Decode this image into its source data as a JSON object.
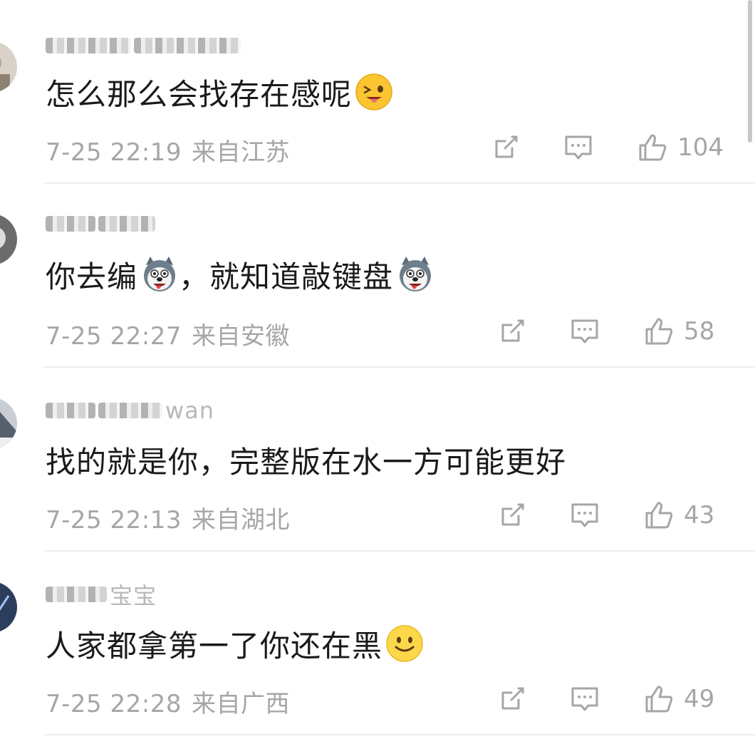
{
  "comments": [
    {
      "username": "",
      "text": "怎么那么会找存在感呢",
      "emoji": "wink-tongue-emoji",
      "time": "7-25 22:19",
      "location": "来自江苏",
      "likes": "104"
    },
    {
      "username": "",
      "text": "你去编",
      "text2": "，就知道敲键盘",
      "emoji": "husky-emoji",
      "time": "7-25 22:27",
      "location": "来自安徽",
      "likes": "58"
    },
    {
      "username": "wan",
      "text": "找的就是你，完整版在水一方可能更好",
      "time": "7-25 22:13",
      "location": "来自湖北",
      "likes": "43"
    },
    {
      "username": "宝宝",
      "text": "人家都拿第一了你还在黑",
      "emoji": "smile-emoji",
      "time": "7-25 22:28",
      "location": "来自广西",
      "likes": "49"
    }
  ],
  "colors": {
    "text": "#1a1a1a",
    "meta": "#a6a6a6",
    "divider": "#ececec"
  },
  "icons": {
    "share": "share-icon",
    "reply": "comment-icon",
    "like": "thumbs-up-icon"
  }
}
